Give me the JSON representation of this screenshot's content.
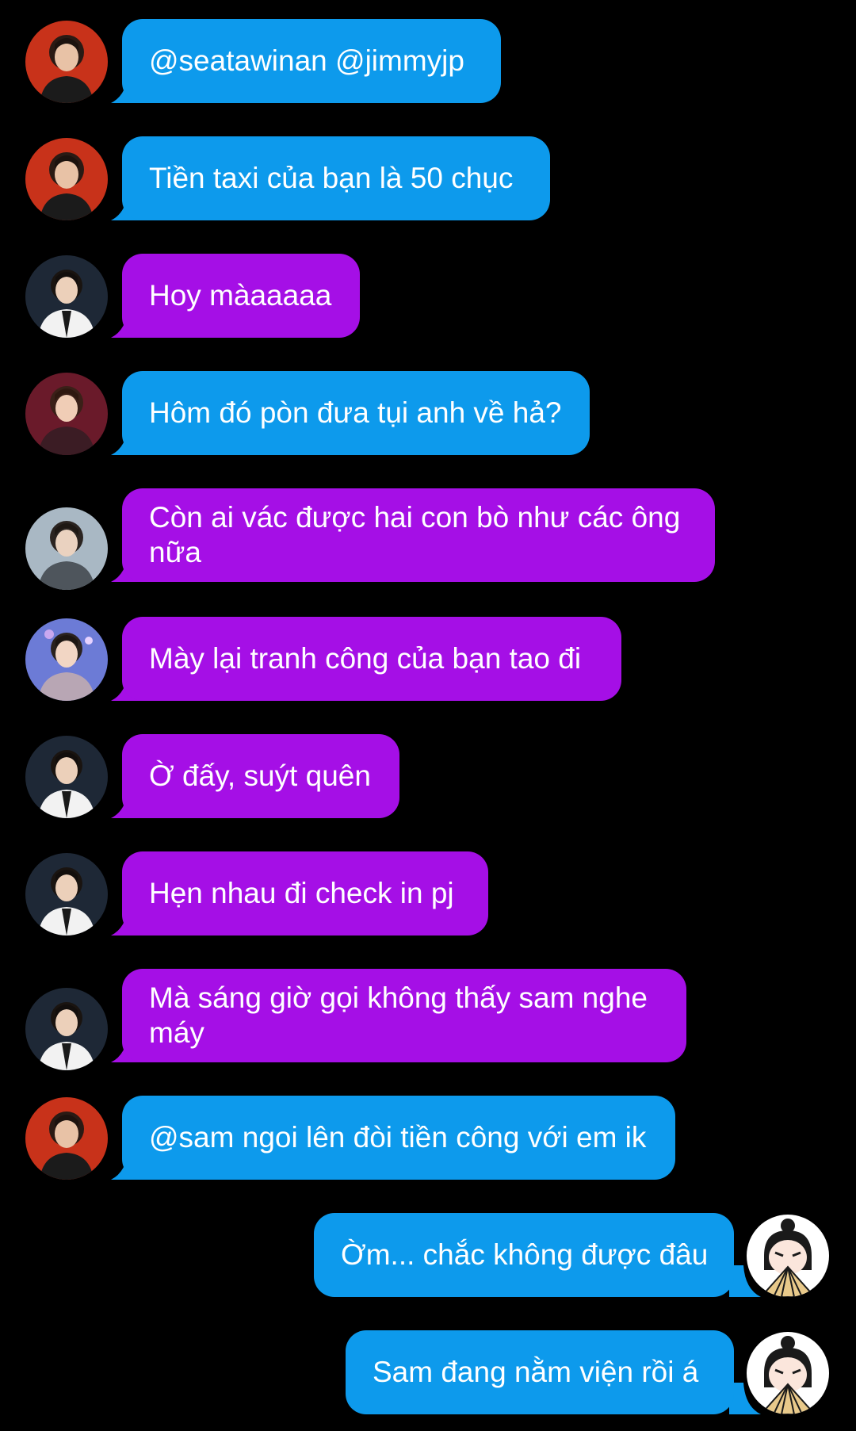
{
  "colors": {
    "background": "#000000",
    "bubble_blue": "#0d9aec",
    "bubble_purple": "#a50fe6",
    "text": "#ffffff"
  },
  "messages": [
    {
      "sender_avatar": "avatar-red-stage-person",
      "side": "left",
      "color": "blue",
      "text": "@seatawinan @jimmyjp"
    },
    {
      "sender_avatar": "avatar-red-stage-person",
      "side": "left",
      "color": "blue",
      "text": "Tiền taxi của bạn là 50 chục"
    },
    {
      "sender_avatar": "avatar-white-suit-person",
      "side": "left",
      "color": "purple",
      "text": "Hoy màaaaaa"
    },
    {
      "sender_avatar": "avatar-maroon-person",
      "side": "left",
      "color": "blue",
      "text": "Hôm đó pòn đưa tụi anh về hả?"
    },
    {
      "sender_avatar": "avatar-grey-jacket-person",
      "side": "left",
      "color": "purple",
      "text": "Còn ai vác được hai con bò như các ông nữa"
    },
    {
      "sender_avatar": "avatar-sequin-person",
      "side": "left",
      "color": "purple",
      "text": "Mày lại tranh công của bạn tao đi"
    },
    {
      "sender_avatar": "avatar-white-suit-person",
      "side": "left",
      "color": "purple",
      "text": "Ờ đấy, suýt quên"
    },
    {
      "sender_avatar": "avatar-white-suit-person",
      "side": "left",
      "color": "purple",
      "text": "Hẹn nhau đi check in pj"
    },
    {
      "sender_avatar": "avatar-white-suit-person",
      "side": "left",
      "color": "purple",
      "text": "Mà sáng giờ gọi không thấy sam nghe máy"
    },
    {
      "sender_avatar": "avatar-red-stage-person",
      "side": "left",
      "color": "blue",
      "text": "@sam ngoi lên đòi tiền công với em ik"
    },
    {
      "sender_avatar": "avatar-cartoon-fan-girl",
      "side": "right",
      "color": "blue",
      "text": "Ờm... chắc không được đâu"
    },
    {
      "sender_avatar": "avatar-cartoon-fan-girl",
      "side": "right",
      "color": "blue",
      "text": "Sam đang nằm viện rồi á"
    }
  ]
}
